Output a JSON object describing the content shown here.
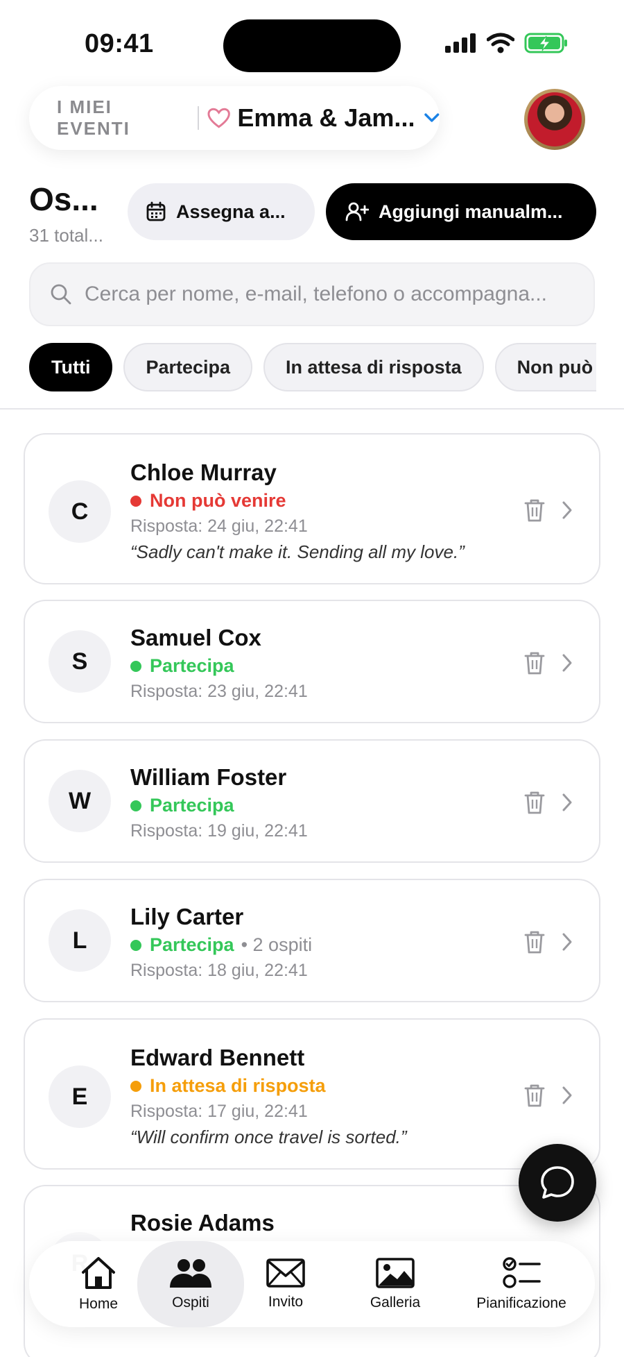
{
  "status_bar": {
    "time": "09:41"
  },
  "header": {
    "kicker": "I MIEI EVENTI",
    "event_name": "Emma & Jam...",
    "accent_color": "#1a82e6",
    "heart_color": "#e37a96"
  },
  "page": {
    "title": "Os...",
    "subtitle": "31 total...",
    "assign_label": "Assegna a...",
    "add_label": "Aggiungi manualm..."
  },
  "search": {
    "placeholder": "Cerca per nome, e-mail, telefono o accompagna...",
    "value": ""
  },
  "filters": [
    {
      "label": "Tutti",
      "active": true
    },
    {
      "label": "Partecipa",
      "active": false
    },
    {
      "label": "In attesa di risposta",
      "active": false
    },
    {
      "label": "Non può venire",
      "active": false
    }
  ],
  "status_colors": {
    "declined": "#e53935",
    "attending": "#34c759",
    "pending": "#f59e0b"
  },
  "guests": [
    {
      "initial": "C",
      "name": "Chloe Murray",
      "status": "Non può venire",
      "status_key": "declined",
      "extra": "",
      "response": "Risposta: 24 giu, 22:41",
      "note": "“Sadly can't make it. Sending all my love.”"
    },
    {
      "initial": "S",
      "name": "Samuel Cox",
      "status": "Partecipa",
      "status_key": "attending",
      "extra": "",
      "response": "Risposta: 23 giu, 22:41",
      "note": ""
    },
    {
      "initial": "W",
      "name": "William Foster",
      "status": "Partecipa",
      "status_key": "attending",
      "extra": "",
      "response": "Risposta: 19 giu, 22:41",
      "note": ""
    },
    {
      "initial": "L",
      "name": "Lily Carter",
      "status": "Partecipa",
      "status_key": "attending",
      "extra": "• 2 ospiti",
      "response": "Risposta: 18 giu, 22:41",
      "note": ""
    },
    {
      "initial": "E",
      "name": "Edward Bennett",
      "status": "In attesa di risposta",
      "status_key": "pending",
      "extra": "",
      "response": "Risposta: 17 giu, 22:41",
      "note": "“Will confirm once travel is sorted.”"
    },
    {
      "initial": "R",
      "name": "Rosie Adams"
    }
  ],
  "nav": [
    {
      "label": "Home",
      "icon": "home-icon"
    },
    {
      "label": "Ospiti",
      "icon": "guests-icon",
      "active": true
    },
    {
      "label": "Invito",
      "icon": "mail-icon"
    },
    {
      "label": "Galleria",
      "icon": "gallery-icon"
    },
    {
      "label": "Pianificazione",
      "icon": "checklist-icon"
    }
  ]
}
